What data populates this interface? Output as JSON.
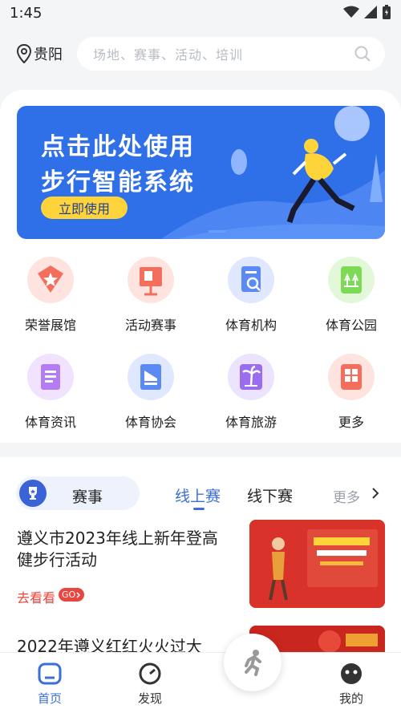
{
  "status_bar": {
    "time": "1:45"
  },
  "location": {
    "city": "贵阳"
  },
  "search": {
    "placeholder": "场地、赛事、活动、培训"
  },
  "banner": {
    "line1": "点击此处使用",
    "line2": "步行智能系统",
    "button": "立即使用"
  },
  "grid": [
    {
      "label": "荣誉展馆",
      "icon": "medal-icon"
    },
    {
      "label": "活动赛事",
      "icon": "easel-icon"
    },
    {
      "label": "体育机构",
      "icon": "document-search-icon"
    },
    {
      "label": "体育公园",
      "icon": "park-icon"
    },
    {
      "label": "体育资讯",
      "icon": "news-icon"
    },
    {
      "label": "体育协会",
      "icon": "stadium-icon"
    },
    {
      "label": "体育旅游",
      "icon": "palm-tree-icon"
    },
    {
      "label": "更多",
      "icon": "more-apps-icon"
    }
  ],
  "events": {
    "section_label": "赛事",
    "tabs": [
      "线上赛",
      "线下赛"
    ],
    "active_tab": "线上赛",
    "more": "更多",
    "items": [
      {
        "title": "遵义市2023年线上新年登高健步行活动",
        "link": "去看看",
        "badge": "GO"
      },
      {
        "title": "2022年遵义红红火火过大"
      }
    ]
  },
  "bottom_nav": [
    {
      "label": "首页",
      "active": true
    },
    {
      "label": "发现",
      "active": false
    },
    {
      "label": "我的",
      "active": false
    }
  ],
  "colors": {
    "accent": "#3b6fd8",
    "banner_bg": "#2f6fe8",
    "link_red": "#e8463e"
  }
}
